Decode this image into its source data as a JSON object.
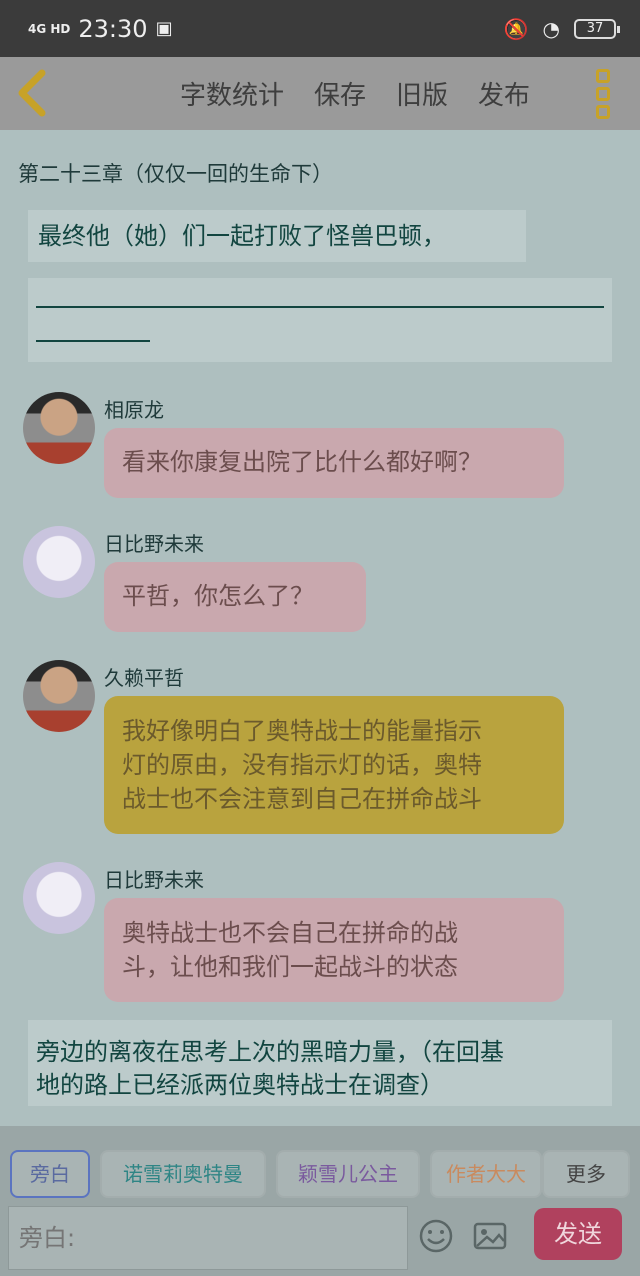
{
  "status_bar": {
    "network": "4G HD",
    "time": "23:30",
    "battery": "37"
  },
  "toolbar": {
    "back_icon": "chevron-left-icon",
    "items": [
      "字数统计",
      "保存",
      "旧版",
      "发布"
    ],
    "menu_icon": "more-vertical-icon",
    "accent": "#c7a228"
  },
  "chapter": {
    "title": "第二十三章（仅仅一回的生命下）"
  },
  "narrations": {
    "first": "最终他（她）们一起打败了怪兽巴顿，",
    "last_line1": "旁边的离夜在思考上次的黑暗力量，（在回基",
    "last_line2": "地的路上已经派两位奥特战士在调查）"
  },
  "messages": [
    {
      "speaker": "相原龙",
      "lines": [
        "看来你康复出院了比什么都好啊？"
      ],
      "color": "#c9a8ae"
    },
    {
      "speaker": "日比野未来",
      "lines": [
        "平哲，你怎么了？"
      ],
      "color": "#c9a8ae"
    },
    {
      "speaker": "久赖平哲",
      "lines": [
        "我好像明白了奥特战士的能量指示",
        "灯的原由，没有指示灯的话，奥特",
        "战士也不会注意到自己在拼命战斗"
      ],
      "color": "#b9a33e"
    },
    {
      "speaker": "日比野未来",
      "lines": [
        "奥特战士也不会自己在拼命的战",
        "斗，让他和我们一起战斗的状态"
      ],
      "color": "#c9a8ae"
    }
  ],
  "roles": {
    "narrator": "旁白",
    "role1": "诺雪莉奥特曼",
    "role2": "颖雪儿公主",
    "role3": "作者大大",
    "more": "更多"
  },
  "input": {
    "placeholder": "旁白:",
    "send_label": "发送",
    "emoji_icon": "emoji-icon",
    "image_icon": "image-icon"
  }
}
